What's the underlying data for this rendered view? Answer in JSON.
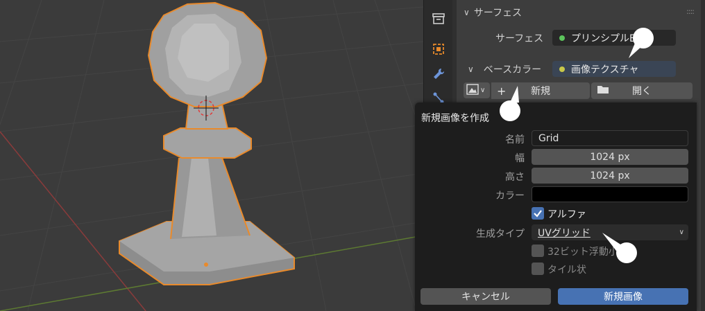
{
  "panel": {
    "section_title": "サーフェス",
    "surface_label": "サーフェス",
    "surface_value": "プリンシプルB",
    "base_color_label": "ベースカラー",
    "base_color_value": "画像テクスチャ",
    "new_button": "新規",
    "open_button": "開く",
    "plus_glyph": "+",
    "drag_grip": "::::"
  },
  "popup": {
    "title": "新規画像を作成",
    "name_label": "名前",
    "name_value": "Grid",
    "width_label": "幅",
    "width_value": "1024 px",
    "height_label": "高さ",
    "height_value": "1024 px",
    "color_label": "カラー",
    "alpha_label": "アルファ",
    "alpha_checked": true,
    "gen_type_label": "生成タイプ",
    "gen_type_value": "UVグリッド",
    "float_label": "32ビット浮動小",
    "float_checked": false,
    "tiled_label": "タイル状",
    "tiled_checked": false,
    "cancel_button": "キャンセル",
    "create_button": "新規画像"
  },
  "colors": {
    "accent_blue": "#4772b3",
    "selection_orange": "#e98a2b",
    "surface_dot": "#5cc45c",
    "base_color_dot": "#c8c84a"
  },
  "icons": [
    "archive-icon",
    "object-icon",
    "wrench-icon",
    "particles-icon",
    "chevron-down-icon",
    "image-icon",
    "folder-icon",
    "checkmark-icon",
    "cursor-3d-icon"
  ]
}
